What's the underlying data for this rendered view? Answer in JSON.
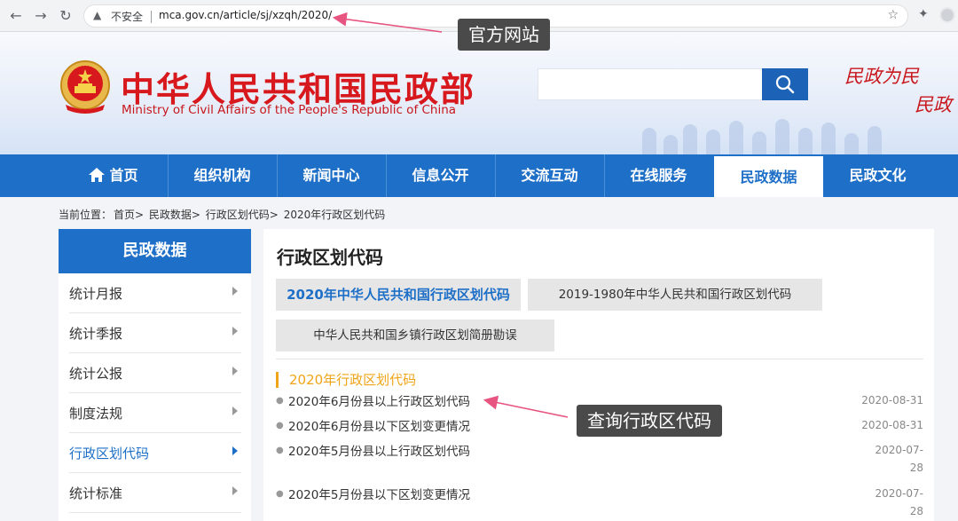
{
  "browser": {
    "insecure_label": "不安全",
    "url": "mca.gov.cn/article/sj/xzqh/2020/"
  },
  "header": {
    "title": "中华人民共和国民政部",
    "subtitle": "Ministry of Civil Affairs of the People's Republic of China",
    "search_placeholder": "",
    "slogan_line1": "民政为民",
    "slogan_line2": "民政"
  },
  "nav": {
    "items": [
      {
        "label": "首页"
      },
      {
        "label": "组织机构"
      },
      {
        "label": "新闻中心"
      },
      {
        "label": "信息公开"
      },
      {
        "label": "交流互动"
      },
      {
        "label": "在线服务"
      },
      {
        "label": "民政数据"
      },
      {
        "label": "民政文化"
      }
    ],
    "active_index": 6
  },
  "breadcrumb": {
    "prefix": "当前位置：",
    "items": [
      "首页>",
      "民政数据>",
      "行政区划代码>",
      "2020年行政区划代码"
    ]
  },
  "sidebar": {
    "title": "民政数据",
    "items": [
      {
        "label": "统计月报"
      },
      {
        "label": "统计季报"
      },
      {
        "label": "统计公报"
      },
      {
        "label": "制度法规"
      },
      {
        "label": "行政区划代码"
      },
      {
        "label": "统计标准"
      }
    ],
    "active_index": 4
  },
  "content": {
    "title": "行政区划代码",
    "tabs": [
      {
        "label": "2020年中华人民共和国行政区划代码"
      },
      {
        "label": "2019-1980年中华人民共和国行政区划代码"
      },
      {
        "label": "中华人民共和国乡镇行政区划简册勘误"
      }
    ],
    "section_title": "2020年行政区划代码",
    "list": [
      {
        "title": "2020年6月份县以上行政区划代码",
        "date": "2020-08-31"
      },
      {
        "title": "2020年6月份县以下区划变更情况",
        "date": "2020-08-31"
      },
      {
        "title": "2020年5月份县以上行政区划代码",
        "date": "2020-07-28"
      },
      {
        "title": "2020年5月份县以下区划变更情况",
        "date": "2020-07-28"
      }
    ]
  },
  "annotations": {
    "official_site": "官方网站",
    "query_code": "查询行政区代码"
  },
  "colors": {
    "nav_blue": "#1e6fc7",
    "brand_red": "#d7191e",
    "section_orange": "#f0a417",
    "callout_bg": "#4a4a4a",
    "annotation_arrow": "#e75480"
  }
}
